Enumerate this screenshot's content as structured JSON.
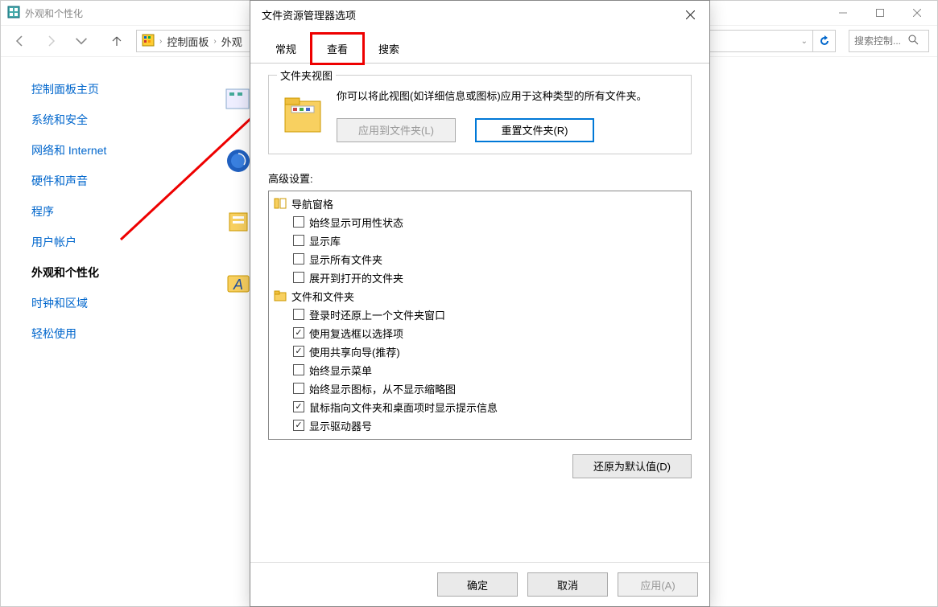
{
  "window": {
    "title": "外观和个性化",
    "breadcrumb": {
      "item1": "控制面板",
      "item2": "外观"
    },
    "search_placeholder": "搜索控制..."
  },
  "sidebar": {
    "items": [
      {
        "label": "控制面板主页"
      },
      {
        "label": "系统和安全"
      },
      {
        "label": "网络和 Internet"
      },
      {
        "label": "硬件和声音"
      },
      {
        "label": "程序"
      },
      {
        "label": "用户帐户"
      },
      {
        "label": "外观和个性化"
      },
      {
        "label": "时钟和区域"
      },
      {
        "label": "轻松使用"
      }
    ]
  },
  "dialog": {
    "title": "文件资源管理器选项",
    "tabs": {
      "general": "常规",
      "view": "查看",
      "search": "搜索"
    },
    "group_title": "文件夹视图",
    "group_text": "你可以将此视图(如详细信息或图标)应用于这种类型的所有文件夹。",
    "btn_apply_folders": "应用到文件夹(L)",
    "btn_reset_folders": "重置文件夹(R)",
    "adv_label": "高级设置:",
    "tree": {
      "g1": "导航窗格",
      "g1_items": [
        {
          "label": "始终显示可用性状态",
          "checked": false
        },
        {
          "label": "显示库",
          "checked": false
        },
        {
          "label": "显示所有文件夹",
          "checked": false
        },
        {
          "label": "展开到打开的文件夹",
          "checked": false
        }
      ],
      "g2": "文件和文件夹",
      "g2_items": [
        {
          "label": "登录时还原上一个文件夹窗口",
          "checked": false
        },
        {
          "label": "使用复选框以选择项",
          "checked": true
        },
        {
          "label": "使用共享向导(推荐)",
          "checked": true
        },
        {
          "label": "始终显示菜单",
          "checked": false
        },
        {
          "label": "始终显示图标，从不显示缩略图",
          "checked": false
        },
        {
          "label": "鼠标指向文件夹和桌面项时显示提示信息",
          "checked": true
        },
        {
          "label": "显示驱动器号",
          "checked": true
        }
      ]
    },
    "btn_restore": "还原为默认值(D)",
    "btn_ok": "确定",
    "btn_cancel": "取消",
    "btn_apply": "应用(A)"
  }
}
